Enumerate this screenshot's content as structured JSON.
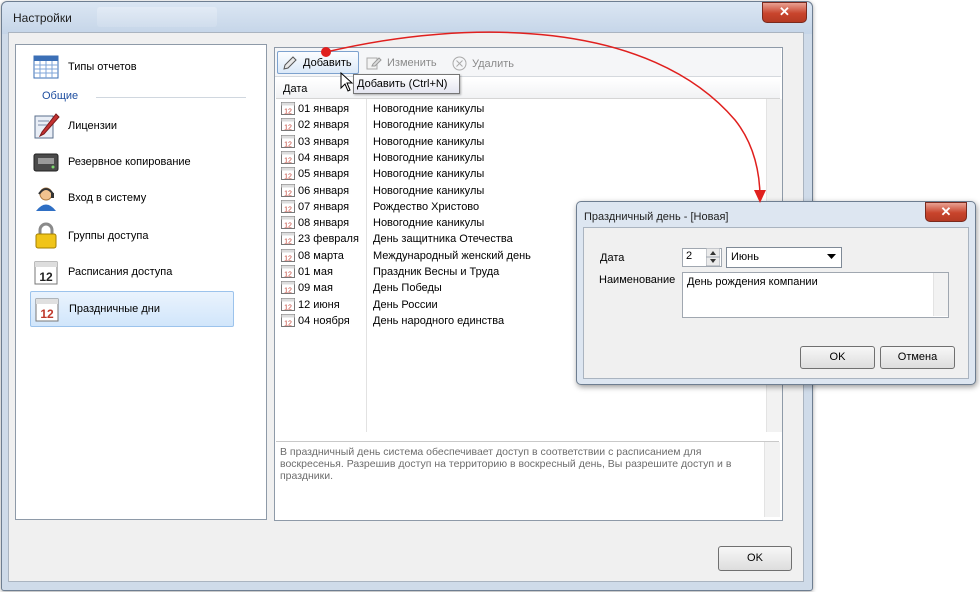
{
  "window": {
    "title": "Настройки",
    "close_symbol": "✕"
  },
  "sidebar": {
    "group_label": "Общие",
    "items": [
      {
        "label": "Типы отчетов",
        "icon": "calendar-grid-icon"
      },
      {
        "label": "Лицензии",
        "icon": "certificate-pen-icon"
      },
      {
        "label": "Резервное копирование",
        "icon": "tape-drive-icon"
      },
      {
        "label": "Вход в систему",
        "icon": "user-headset-icon"
      },
      {
        "label": "Группы доступа",
        "icon": "padlock-icon"
      },
      {
        "label": "Расписания доступа",
        "icon": "calendar-12-icon"
      },
      {
        "label": "Праздничные дни",
        "icon": "holiday-calendar-icon"
      }
    ],
    "selected": "Праздничные дни"
  },
  "toolbar": {
    "add_label": "Добавить",
    "edit_label": "Изменить",
    "delete_label": "Удалить",
    "tooltip": "Добавить (Ctrl+N)"
  },
  "grid": {
    "column_date": "Дата",
    "rows": [
      {
        "date": "01 января",
        "name": "Новогодние каникулы"
      },
      {
        "date": "02 января",
        "name": "Новогодние каникулы"
      },
      {
        "date": "03 января",
        "name": "Новогодние каникулы"
      },
      {
        "date": "04 января",
        "name": "Новогодние каникулы"
      },
      {
        "date": "05 января",
        "name": "Новогодние каникулы"
      },
      {
        "date": "06 января",
        "name": "Новогодние каникулы"
      },
      {
        "date": "07 января",
        "name": "Рождество Христово"
      },
      {
        "date": "08 января",
        "name": "Новогодние каникулы"
      },
      {
        "date": "23 февраля",
        "name": "День защитника Отечества"
      },
      {
        "date": "08 марта",
        "name": "Международный женский день"
      },
      {
        "date": "01 мая",
        "name": "Праздник Весны и Труда"
      },
      {
        "date": "09 мая",
        "name": "День Победы"
      },
      {
        "date": "12 июня",
        "name": "День России"
      },
      {
        "date": "04 ноября",
        "name": "День народного единства"
      }
    ],
    "calendar_badge": "12"
  },
  "description": "В праздничный день система обеспечивает доступ в соответствии с расписанием для воскресенья. Разрешив доступ на территорию в воскресный день, Вы разрешите доступ и в праздники.",
  "footer": {
    "ok_label": "OK"
  },
  "dialog": {
    "title": "Праздничный день -  [Новая]",
    "date_label": "Дата",
    "day_value": "2",
    "month_value": "Июнь",
    "name_label": "Наименование",
    "name_value": "День рождения компании",
    "ok_label": "OK",
    "cancel_label": "Отмена"
  },
  "colors": {
    "annotation_red": "#e0201e",
    "selection_border": "#9cc3ec",
    "header_blue": "#1f4fa0"
  }
}
